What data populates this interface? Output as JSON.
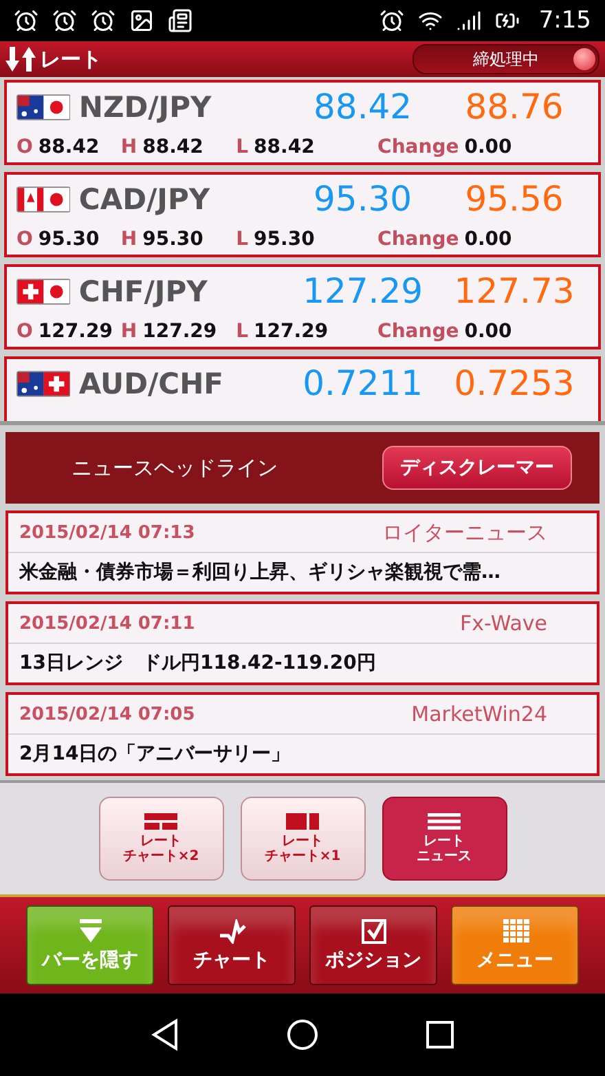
{
  "status_bar": {
    "time": "7:15"
  },
  "header": {
    "title": "レート",
    "status": "締処理中"
  },
  "rates": [
    {
      "pair": "NZD/JPY",
      "bid": "88.42",
      "ask": "88.76",
      "open_label": "O",
      "open": "88.42",
      "high_label": "H",
      "high": "88.42",
      "low_label": "L",
      "low": "88.42",
      "change_label": "Change",
      "change": "0.00"
    },
    {
      "pair": "CAD/JPY",
      "bid": "95.30",
      "ask": "95.56",
      "open_label": "O",
      "open": "95.30",
      "high_label": "H",
      "high": "95.30",
      "low_label": "L",
      "low": "95.30",
      "change_label": "Change",
      "change": "0.00"
    },
    {
      "pair": "CHF/JPY",
      "bid": "127.29",
      "ask": "127.73",
      "open_label": "O",
      "open": "127.29",
      "high_label": "H",
      "high": "127.29",
      "low_label": "L",
      "low": "127.29",
      "change_label": "Change",
      "change": "0.00"
    },
    {
      "pair": "AUD/CHF",
      "bid": "0.7211",
      "ask": "0.7253"
    }
  ],
  "news": {
    "title": "ニュースヘッドライン",
    "disclaimer_button": "ディスクレーマー",
    "items": [
      {
        "time": "2015/02/14 07:13",
        "source": "ロイターニュース",
        "headline": "米金融・債券市場＝利回り上昇、ギリシャ楽観視で需…"
      },
      {
        "time": "2015/02/14 07:11",
        "source": "Fx-Wave",
        "headline": "13日レンジ　ドル円118.42-119.20円"
      },
      {
        "time": "2015/02/14 07:05",
        "source": "MarketWin24",
        "headline": "2月14日の「アニバーサリー」"
      }
    ]
  },
  "layout_tabs": [
    {
      "lines": [
        "レート",
        "チャート×2"
      ],
      "selected": false
    },
    {
      "lines": [
        "レート",
        "チャート×1"
      ],
      "selected": false
    },
    {
      "lines": [
        "レート",
        "ニュース"
      ],
      "selected": true
    }
  ],
  "toolbar": [
    {
      "label": "バーを隠す",
      "color": "#6fb51c"
    },
    {
      "label": "チャート",
      "color": "#a8101e"
    },
    {
      "label": "ポジション",
      "color": "#a8101e"
    },
    {
      "label": "メニュー",
      "color": "#f07d0a"
    }
  ]
}
